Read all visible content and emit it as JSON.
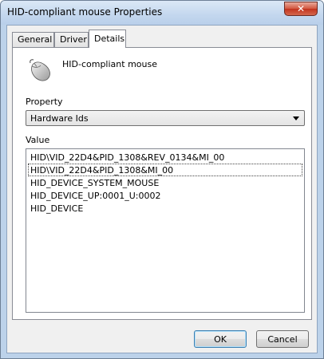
{
  "window": {
    "title": "HID-compliant mouse Properties",
    "close_label": "✕"
  },
  "tabs": [
    {
      "label": "General"
    },
    {
      "label": "Driver"
    },
    {
      "label": "Details"
    }
  ],
  "device": {
    "name": "HID-compliant mouse",
    "icon": "mouse-icon"
  },
  "property": {
    "label": "Property",
    "selected": "Hardware Ids"
  },
  "value": {
    "label": "Value",
    "items": [
      "HID\\VID_22D4&PID_1308&REV_0134&MI_00",
      "HID\\VID_22D4&PID_1308&MI_00",
      "HID_DEVICE_SYSTEM_MOUSE",
      "HID_DEVICE_UP:0001_U:0002",
      "HID_DEVICE"
    ],
    "selected_index": 1
  },
  "buttons": {
    "ok": "OK",
    "cancel": "Cancel"
  }
}
